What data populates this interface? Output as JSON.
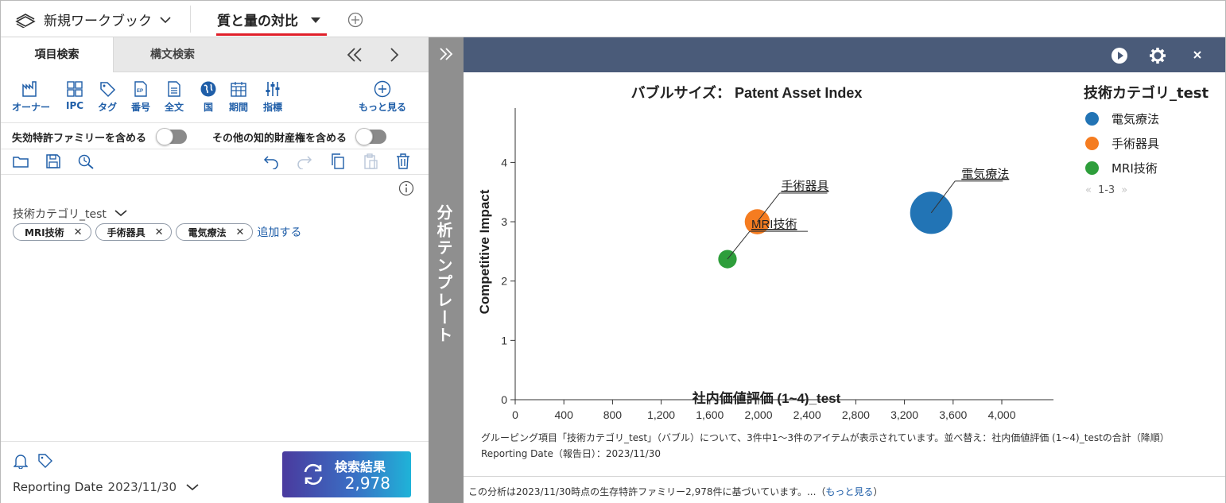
{
  "workbook": {
    "title": "新規ワークブック"
  },
  "doc_tab": {
    "title": "質と量の対比"
  },
  "left": {
    "tabs": [
      "項目検索",
      "構文検索"
    ],
    "icons": [
      "オーナー",
      "IPC",
      "タグ",
      "番号",
      "全文",
      "国",
      "期間",
      "指標",
      "もっと見る"
    ],
    "toggle1": "失効特許ファミリーを含める",
    "toggle2": "その他の知的財産権を含める",
    "field_label": "技術カテゴリ_test",
    "chips": [
      "MRI技術",
      "手術器具",
      "電気療法"
    ],
    "add_label": "追加する",
    "reporting_label": "Reporting Date",
    "reporting_value": "2023/11/30",
    "search_label": "検索結果",
    "search_count": "2,978"
  },
  "strip": {
    "label": "分析テンプレート"
  },
  "chart_data": {
    "type": "scatter",
    "title": "バブルサイズ： Patent Asset Index",
    "xlabel": "社内価値評価 (1~4)_test",
    "ylabel": "Competitive Impact",
    "xlim": [
      0,
      4500
    ],
    "ylim": [
      0,
      4.3
    ],
    "xticks": [
      0,
      400,
      800,
      1200,
      1600,
      2000,
      2400,
      2800,
      3200,
      3600,
      4000
    ],
    "xtick_labels": [
      "0",
      "400",
      "800",
      "1,200",
      "1,600",
      "2,000",
      "2,400",
      "2,800",
      "3,200",
      "3,600",
      "4,000"
    ],
    "yticks": [
      0,
      1,
      2,
      3,
      4
    ],
    "ytick_labels": [
      "0",
      "1",
      "2",
      "3",
      "4"
    ],
    "grid": false,
    "legend_title": "技術カテゴリ_test",
    "legend_position": "right",
    "legend_pager": "1-3",
    "series": [
      {
        "name": "電気療法",
        "x": 3420,
        "y": 3.15,
        "size": 3.2,
        "color": "#2274b5"
      },
      {
        "name": "手術器具",
        "x": 1990,
        "y": 3.0,
        "size": 1.9,
        "color": "#f57c20"
      },
      {
        "name": "MRI技術",
        "x": 1745,
        "y": 2.37,
        "size": 1.4,
        "color": "#2e9e3b"
      }
    ]
  },
  "description": "グルーピング項目「技術カテゴリ_test」（バブル）について、3件中1〜3件のアイテムが表示されています。並べ替え：社内価値評価 (1~4)_testの合計（降順）Reporting Date（報告日）：2023/11/30",
  "footer": {
    "text": "この分析は2023/11/30時点の生存特許ファミリー2,978件に基づいています。...（",
    "link": "もっと見る",
    "close": "）"
  }
}
